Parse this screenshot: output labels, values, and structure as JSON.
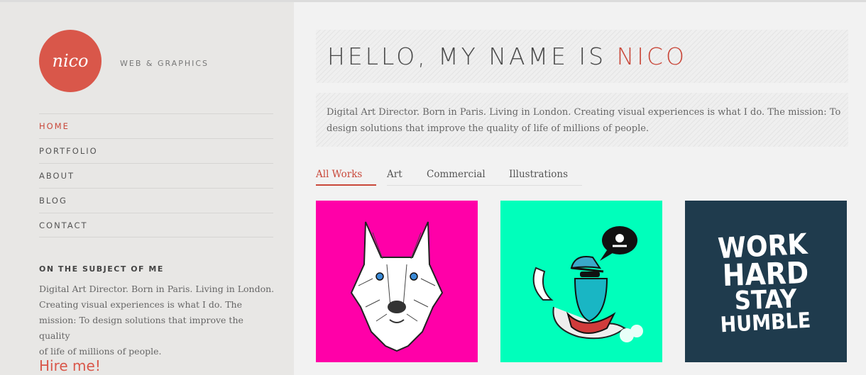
{
  "logo": {
    "text": "nico",
    "color": "#d9574a"
  },
  "tagline": "WEB & GRAPHICS",
  "nav": {
    "items": [
      {
        "label": "HOME",
        "active": true
      },
      {
        "label": "PORTFOLIO",
        "active": false
      },
      {
        "label": "ABOUT",
        "active": false
      },
      {
        "label": "BLOG",
        "active": false
      },
      {
        "label": "CONTACT",
        "active": false
      }
    ]
  },
  "about": {
    "title": "ON THE SUBJECT OF ME",
    "lines": [
      "Digital Art Director. Born in Paris. Living in London.",
      "Creating visual experiences is what I do. The",
      "mission: To design solutions that improve the quality",
      "of life of millions of people."
    ]
  },
  "hire": "Hire me!",
  "hero": {
    "prefix": "HELLO, MY NAME IS ",
    "name": "NICO"
  },
  "intro": "Digital Art Director. Born in Paris. Living in London. Creating visual experiences is what I do. The mission: To design solutions that improve the quality of life of millions of people.",
  "filters": [
    {
      "label": "All Works",
      "active": true
    },
    {
      "label": "Art",
      "active": false
    },
    {
      "label": "Commercial",
      "active": false
    },
    {
      "label": "Illustrations",
      "active": false
    }
  ],
  "portfolio": [
    {
      "icon": "wolf-illustration",
      "bg": "#ff00a8"
    },
    {
      "icon": "bearded-hipster-illustration",
      "bg": "#00ffbb"
    },
    {
      "icon": "work-hard-stay-humble-typography",
      "bg": "#1f3b4d",
      "words": [
        "WORK",
        "HARD",
        "STAY",
        "HUMBLE"
      ]
    }
  ],
  "colors": {
    "accent": "#c9483a",
    "sidebar_bg": "#e8e7e5",
    "page_bg": "#f2f2f2"
  }
}
